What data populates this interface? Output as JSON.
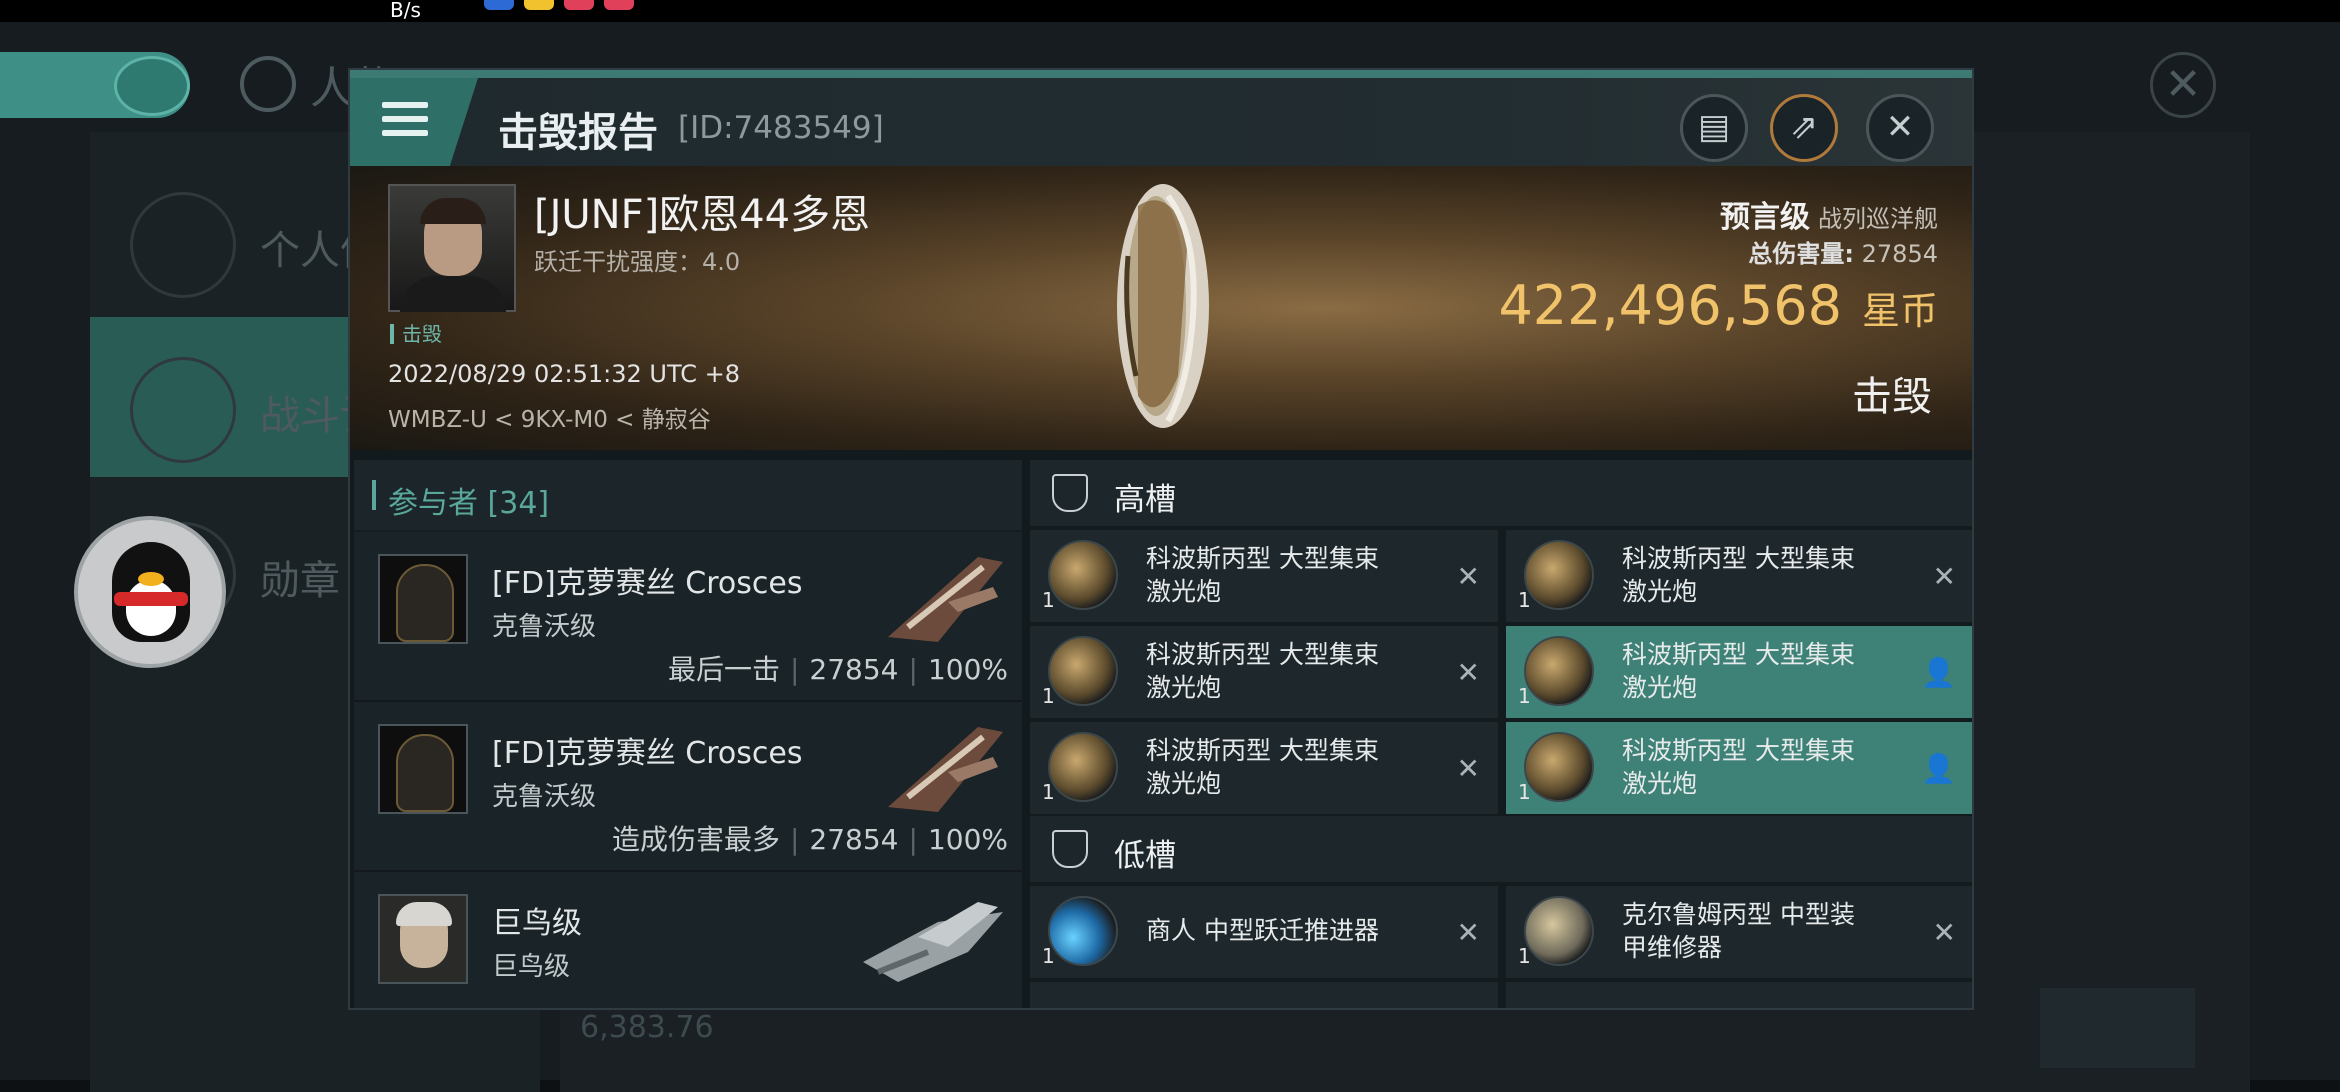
{
  "status_bar": {
    "speed_unit": "B/s"
  },
  "background": {
    "title": "人物",
    "sidebar": [
      {
        "label": "个人信"
      },
      {
        "label": "战斗记"
      },
      {
        "label": "勋章"
      }
    ],
    "bottom_value": "6,383.76"
  },
  "dialog": {
    "title": "击毁报告",
    "report_id": "[ID:7483549]",
    "icons": {
      "menu": "menu-icon",
      "copy": "clipboard-icon",
      "share": "share-icon",
      "close": "close-icon"
    }
  },
  "victim": {
    "name": "[JUNF]欧恩44多恩",
    "warp_disrupt": "跃迁干扰强度：4.0",
    "tag": "击毁",
    "time": "2022/08/29 02:51:32 UTC +8",
    "location": "WMBZ-U < 9KX-M0 < 静寂谷",
    "ship_name": "预言级",
    "ship_class": "战列巡洋舰",
    "total_damage_label": "总伤害量:",
    "total_damage": "27854",
    "isk_value": "422,496,568",
    "isk_unit": "星币",
    "result": "击毁"
  },
  "participants": {
    "header": "参与者 [34]",
    "rows": [
      {
        "name": "[FD]克萝赛丝 Crosces",
        "ship": "克鲁沃级",
        "note": "最后一击",
        "damage": "27854",
        "percent": "100%"
      },
      {
        "name": "[FD]克萝赛丝 Crosces",
        "ship": "克鲁沃级",
        "note": "造成伤害最多",
        "damage": "27854",
        "percent": "100%"
      },
      {
        "name": "巨鸟级",
        "ship": "巨鸟级",
        "note": "",
        "damage": "",
        "percent": ""
      }
    ]
  },
  "fitting": {
    "high_label": "高槽",
    "low_label": "低槽",
    "high": [
      {
        "l1": "科波斯丙型 大型集束",
        "l2": "激光炮",
        "qty": "1",
        "status": "destroyed"
      },
      {
        "l1": "科波斯丙型 大型集束",
        "l2": "激光炮",
        "qty": "1",
        "status": "destroyed"
      },
      {
        "l1": "科波斯丙型 大型集束",
        "l2": "激光炮",
        "qty": "1",
        "status": "destroyed"
      },
      {
        "l1": "科波斯丙型 大型集束",
        "l2": "激光炮",
        "qty": "1",
        "status": "dropped"
      },
      {
        "l1": "科波斯丙型 大型集束",
        "l2": "激光炮",
        "qty": "1",
        "status": "destroyed"
      },
      {
        "l1": "科波斯丙型 大型集束",
        "l2": "激光炮",
        "qty": "1",
        "status": "dropped"
      }
    ],
    "low": [
      {
        "l1": "商人 中型跃迁推进器",
        "l2": "",
        "qty": "1",
        "status": "destroyed"
      },
      {
        "l1": "克尔鲁姆丙型 中型装",
        "l2": "甲维修器",
        "qty": "1",
        "status": "destroyed"
      }
    ]
  },
  "colors": {
    "accent": "#3e8176",
    "isk": "#f0c36a",
    "teal_text": "#5aa89c"
  }
}
